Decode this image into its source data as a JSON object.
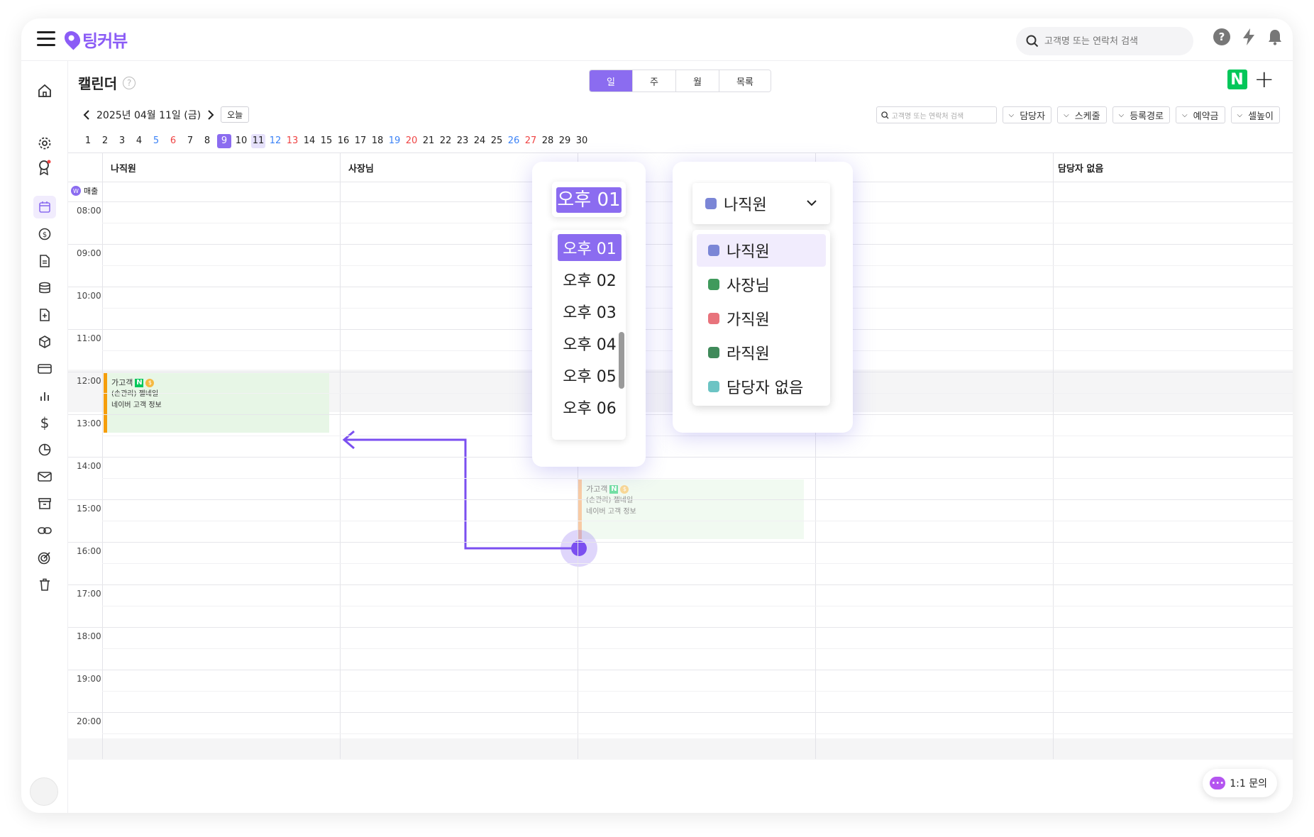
{
  "app": {
    "logo_text": "팅커뷰",
    "search_placeholder": "고객명 또는 연락처 검색"
  },
  "header": {
    "title": "캘린더",
    "view_tabs": [
      "일",
      "주",
      "월",
      "목록"
    ],
    "active_view": "일",
    "date_label": "2025년 04월 11일 (금)",
    "today_label": "오늘"
  },
  "filters": {
    "search_placeholder": "고객명 또는 연락처 검색",
    "buttons": [
      "담당자",
      "스케줄",
      "등록경로",
      "예약금",
      "셀높이"
    ]
  },
  "day_strip": {
    "days": [
      "1",
      "2",
      "3",
      "4",
      "5",
      "6",
      "7",
      "8",
      "9",
      "10",
      "11",
      "12",
      "13",
      "14",
      "15",
      "16",
      "17",
      "18",
      "19",
      "20",
      "21",
      "22",
      "23",
      "24",
      "25",
      "26",
      "27",
      "28",
      "29",
      "30"
    ],
    "selected": "9",
    "highlighted": "11",
    "blue_days": [
      "5",
      "12",
      "19",
      "26"
    ],
    "red_days": [
      "6",
      "13",
      "20",
      "27"
    ]
  },
  "calendar": {
    "columns": [
      "나직원",
      "사장님",
      "",
      "",
      "담당자 없음"
    ],
    "sales_label": "매출",
    "times": [
      "08:00",
      "09:00",
      "10:00",
      "11:00",
      "12:00",
      "13:00",
      "14:00",
      "15:00",
      "16:00",
      "17:00",
      "18:00",
      "19:00",
      "20:00"
    ]
  },
  "events": [
    {
      "title": "가고객",
      "badge_n": "N",
      "badge_coin": "$",
      "line1": "(손관리) 젤네일",
      "line2": "네이버 고객 정보",
      "accent": "#f59e0b",
      "bg": "#e7f6e6"
    }
  ],
  "ghost_event": {
    "title": "가고객",
    "badge_n": "N",
    "badge_coin": "$",
    "line1": "(손관리) 젤네일",
    "line2": "네이버 고객 정보"
  },
  "time_picker": {
    "current": "오후 01",
    "options": [
      "오후 01",
      "오후 02",
      "오후 03",
      "오후 04",
      "오후 05",
      "오후 06"
    ]
  },
  "staff_dropdown": {
    "current": "나직원",
    "current_color": "#7b86d6",
    "options": [
      {
        "label": "나직원",
        "color": "#7b86d6"
      },
      {
        "label": "사장님",
        "color": "#3f9a5c"
      },
      {
        "label": "가직원",
        "color": "#e8737c"
      },
      {
        "label": "라직원",
        "color": "#3f8a5a"
      },
      {
        "label": "담당자 없음",
        "color": "#6cc4c4"
      }
    ]
  },
  "colors": {
    "accent": "#8b6cf0",
    "naver": "#03c75a",
    "drag_arrow": "#7b4ff0"
  },
  "inquiry_label": "1:1 문의"
}
